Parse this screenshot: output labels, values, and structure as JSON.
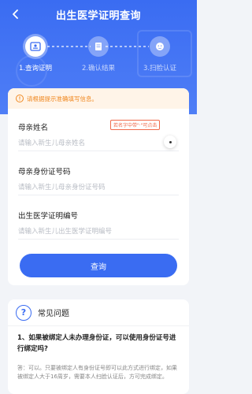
{
  "header": {
    "title": "出生医学证明查询"
  },
  "steps": [
    {
      "label": "1.查询证明",
      "state": "active",
      "icon": "id-card-icon"
    },
    {
      "label": "2.确认结果",
      "state": "inactive",
      "icon": "document-icon"
    },
    {
      "label": "3.扫脸认证",
      "state": "inactive",
      "icon": "face-scan-icon"
    }
  ],
  "notice": {
    "text": "请根据提示准确填写信息。",
    "icon": "warning-icon"
  },
  "form": {
    "mother_name": {
      "label": "母亲姓名",
      "placeholder": "请输入新生儿母亲姓名",
      "value": ""
    },
    "rare_char_tag": "若名字中带\"·\"可点击",
    "mother_id": {
      "label": "母亲身份证号码",
      "placeholder": "请输入新生儿母亲身份证号码",
      "value": ""
    },
    "cert_no": {
      "label": "出生医学证明编号",
      "placeholder": "请输入新生儿出生医学证明编号",
      "value": ""
    },
    "submit_label": "查询"
  },
  "faq": {
    "title": "常见问题",
    "question": "1、如果被绑定人未办理身份证，可以使用身份证号进行绑定吗?",
    "answer": "答：可以。只要被绑定人有身份证号即可以此方式进行绑定，如果被绑定人大于16周岁，需要本人扫脸认证后，方可完成绑定。"
  },
  "colors": {
    "primary": "#3a6cf2",
    "notice_bg": "#fff4e8",
    "notice_text": "#f08a24",
    "tag_red": "#f06a4a",
    "page_bg": "#f2f4f8"
  }
}
